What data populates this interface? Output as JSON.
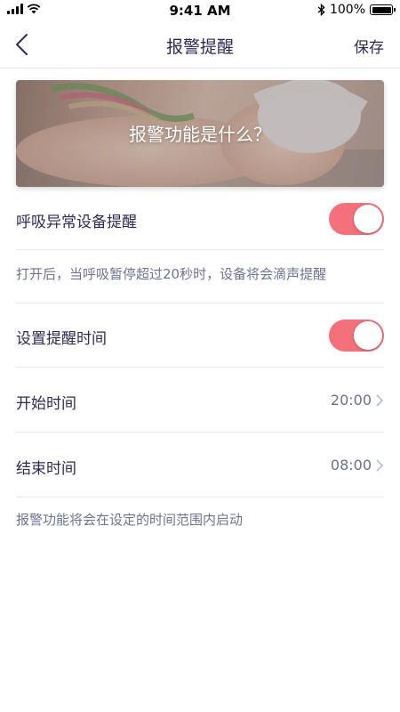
{
  "status_bar": {
    "time": "9:41 AM",
    "battery": "100%"
  },
  "nav": {
    "title": "报警提醒",
    "save_label": "保存"
  },
  "banner": {
    "title": "报警功能是什么？"
  },
  "settings": {
    "breathing_alert": {
      "label": "呼吸异常设备提醒",
      "enabled": true
    },
    "breathing_note": "打开后，当呼吸暂停超过20秒时，设备将会滴声提醒",
    "reminder_time": {
      "label": "设置提醒时间",
      "enabled": true
    },
    "start_time": {
      "label": "开始时间",
      "value": "20:00"
    },
    "end_time": {
      "label": "结束时间",
      "value": "08:00"
    },
    "time_note": "报警功能将会在设定的时间范围内启动"
  },
  "colors": {
    "accent": "#f4717c",
    "text": "#2e2a52",
    "muted": "#6f7392"
  }
}
